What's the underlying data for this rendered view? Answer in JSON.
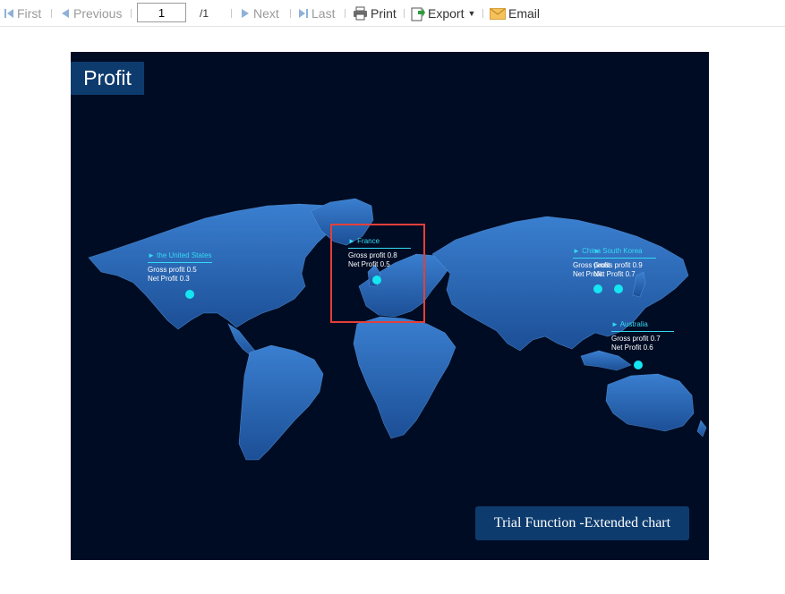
{
  "toolbar": {
    "first": "First",
    "previous": "Previous",
    "page_value": "1",
    "page_total": "/1",
    "next": "Next",
    "last": "Last",
    "print": "Print",
    "export": "Export",
    "email": "Email"
  },
  "report": {
    "title": "Profit",
    "trial_badge": "Trial Function -Extended chart",
    "highlight_color": "#e2403a",
    "background_color": "#000c24",
    "marker_color": "#14e6f2"
  },
  "markers": [
    {
      "country": "the United States",
      "gross": "Gross profit 0.5",
      "net": "Net Profit 0.3"
    },
    {
      "country": "France",
      "gross": "Gross profit 0.8",
      "net": "Net Profit 0.5"
    },
    {
      "country": "China",
      "gross": "Gross profit",
      "net": "Net Profit"
    },
    {
      "country": "South Korea",
      "gross": "Gross profit 0.9",
      "net": "Net Profit 0.7"
    },
    {
      "country": "Australia",
      "gross": "Gross profit 0.7",
      "net": "Net Profit 0.6"
    }
  ]
}
